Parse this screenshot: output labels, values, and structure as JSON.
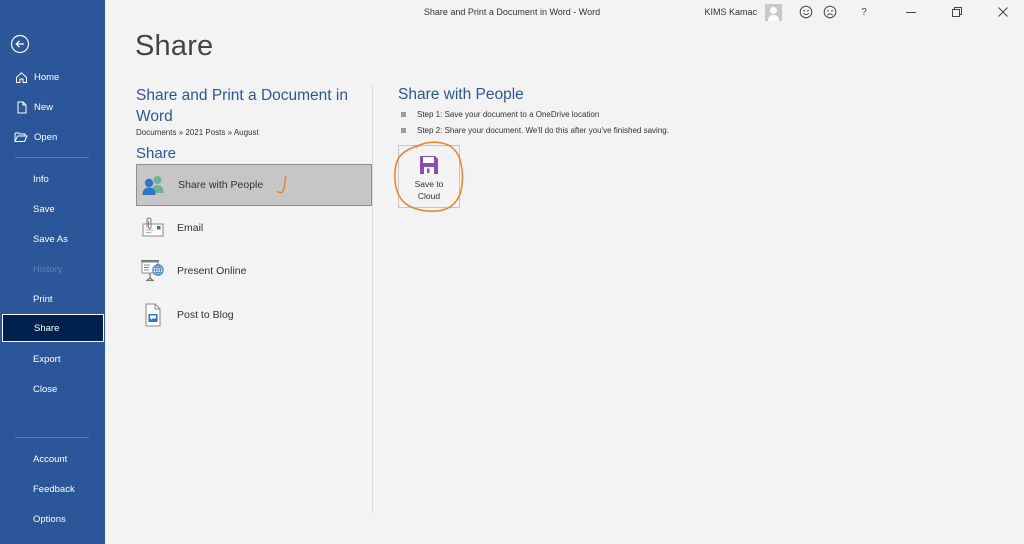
{
  "window": {
    "title": "Share and Print a Document in Word  -  Word",
    "user_name": "KIMS Kamac",
    "buttons": {
      "smile": "smile-feedback-icon",
      "frown": "frown-feedback-icon",
      "help": "?",
      "minimize": "–",
      "restore": "restore-icon",
      "close": "✕"
    }
  },
  "sidebar": {
    "back_icon": "back-arrow-icon",
    "top_items": [
      {
        "label": "Home",
        "icon": "home-icon"
      },
      {
        "label": "New",
        "icon": "new-document-icon"
      },
      {
        "label": "Open",
        "icon": "open-folder-icon"
      }
    ],
    "middle_items": [
      {
        "label": "Info",
        "state": "normal"
      },
      {
        "label": "Save",
        "state": "normal"
      },
      {
        "label": "Save As",
        "state": "normal"
      },
      {
        "label": "History",
        "state": "disabled"
      },
      {
        "label": "Print",
        "state": "normal"
      },
      {
        "label": "Share",
        "state": "active"
      },
      {
        "label": "Export",
        "state": "normal"
      },
      {
        "label": "Close",
        "state": "normal"
      }
    ],
    "bottom_items": [
      {
        "label": "Account"
      },
      {
        "label": "Feedback"
      },
      {
        "label": "Options"
      }
    ]
  },
  "main": {
    "page_title": "Share",
    "document_title": "Share and Print a Document in Word",
    "breadcrumb": "Documents » 2021 Posts » August",
    "section_heading": "Share",
    "share_options": [
      {
        "label": "Share with People",
        "icon": "share-with-people-icon",
        "selected": true
      },
      {
        "label": "Email",
        "icon": "email-icon",
        "selected": false
      },
      {
        "label": "Present Online",
        "icon": "present-online-icon",
        "selected": false
      },
      {
        "label": "Post to Blog",
        "icon": "post-to-blog-icon",
        "selected": false
      }
    ]
  },
  "detail": {
    "heading": "Share with People",
    "steps": [
      "Step 1: Save your document to a OneDrive location",
      "Step 2: Share your document. We'll do this after you've finished saving."
    ],
    "save_button": {
      "label_line1": "Save to",
      "label_line2": "Cloud",
      "icon": "floppy-disk-icon"
    }
  },
  "colors": {
    "accent": "#2b579a",
    "active_nav": "#002050",
    "annotation": "#f07f2a",
    "floppy": "#8a4fb0"
  }
}
